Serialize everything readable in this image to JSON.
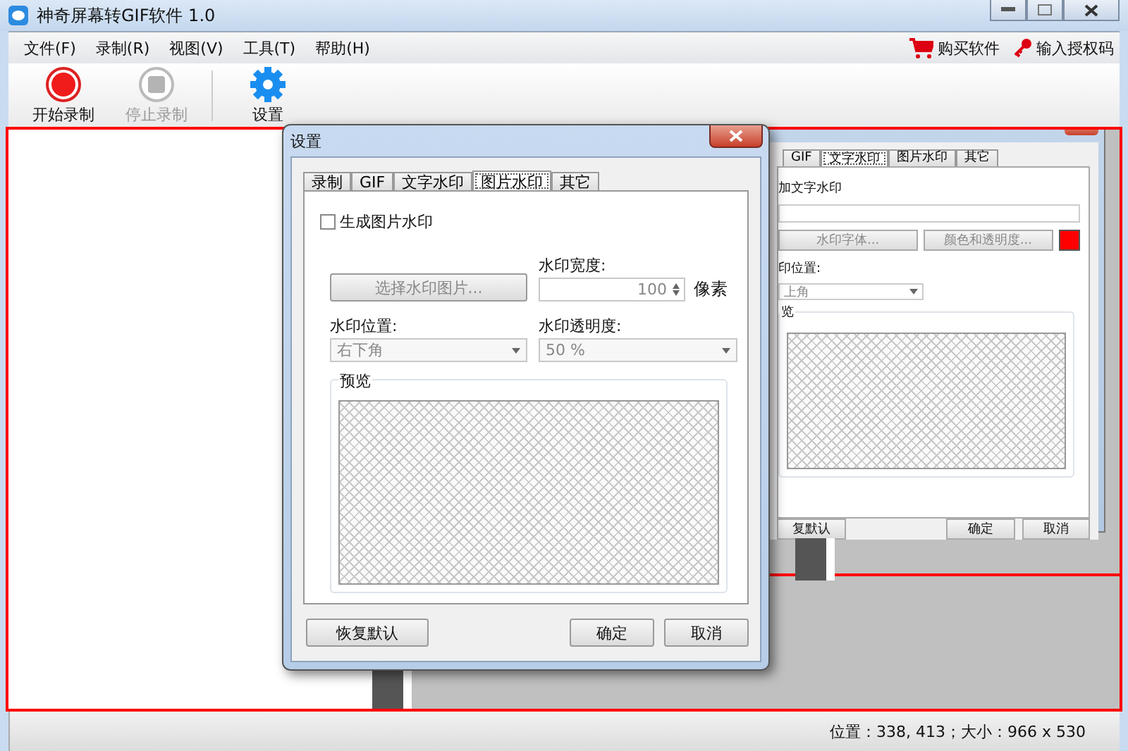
{
  "window": {
    "title": "神奇屏幕转GIF软件 1.0"
  },
  "menu": [
    "文件(F)",
    "录制(R)",
    "视图(V)",
    "工具(T)",
    "帮助(H)"
  ],
  "menu_right": [
    {
      "kind": "cart",
      "label": "购买软件"
    },
    {
      "kind": "key",
      "label": "输入授权码"
    }
  ],
  "toolbar": [
    {
      "kind": "record",
      "label": "开始录制",
      "disabled": false
    },
    {
      "kind": "stop",
      "label": "停止录制",
      "disabled": true
    },
    {
      "kind": "settings",
      "label": "设置",
      "disabled": false
    }
  ],
  "dialog": {
    "title": "设置",
    "tabs": [
      {
        "label": "录制",
        "selected": false
      },
      {
        "label": "GIF",
        "selected": false
      },
      {
        "label": "文字水印",
        "selected": false
      },
      {
        "label": "图片水印",
        "selected": true
      },
      {
        "label": "其它",
        "selected": false
      }
    ],
    "checkbox": {
      "label": "生成图片水印",
      "checked": false
    },
    "choose_button": {
      "label": "选择水印图片...",
      "disabled": true
    },
    "width": {
      "label": "水印宽度:",
      "value": "100",
      "unit": "像素",
      "disabled": true
    },
    "position": {
      "label": "水印位置:",
      "value": "右下角",
      "disabled": true
    },
    "opacity": {
      "label": "水印透明度:",
      "value": "50 %",
      "disabled": true
    },
    "preview": {
      "label": "预览"
    },
    "buttons": {
      "reset": "恢复默认",
      "ok": "确定",
      "cancel": "取消"
    }
  },
  "captured_dialog": {
    "tabs": [
      {
        "label": "GIF",
        "selected": false
      },
      {
        "label": "文字水印",
        "selected": true
      },
      {
        "label": "图片水印",
        "selected": false
      },
      {
        "label": "其它",
        "selected": false
      }
    ],
    "text_label": "加文字水印",
    "font_button": "水印字体...",
    "color_button": "颜色和透明度...",
    "color": "#ff0000",
    "position_label": "印位置:",
    "position_value": "上角",
    "preview_label": "览",
    "buttons": {
      "reset": "复默认",
      "ok": "确定",
      "cancel": "取消"
    }
  },
  "status_bar": {
    "text": "位置：338, 413；大小：966 x 530"
  }
}
